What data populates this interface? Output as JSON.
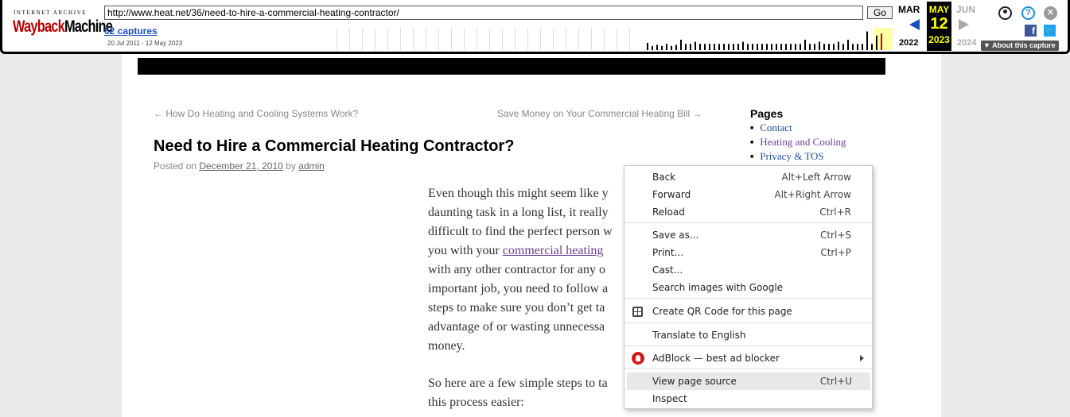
{
  "wayback": {
    "logo_top": "INTERNET ARCHIVE",
    "logo_part1": "Wayback",
    "logo_part2": "Machine",
    "url": "http://www.heat.net/36/need-to-hire-a-commercial-heating-contractor/",
    "go_label": "Go",
    "captures": "62 captures",
    "date_range": "20 Jul 2011 - 12 May 2023",
    "prev_month": "MAR",
    "cur_month": "MAY",
    "cur_day": "12",
    "cur_year": "2023",
    "next_month": "JUN",
    "prev_year": "2022",
    "next_year": "2024",
    "about": "About this capture",
    "help_glyph": "?",
    "close_glyph": "✕",
    "fb_glyph": "f",
    "tw_glyph": "🐦"
  },
  "article": {
    "prev_link": "← How Do Heating and Cooling Systems Work?",
    "next_link": "Save Money on Your Commercial Heating Bill →",
    "title": "Need to Hire a Commercial Heating Contractor?",
    "posted_prefix": "Posted on",
    "posted_date": "December 21, 2010",
    "posted_by": "by",
    "author": "admin",
    "lines": [
      "Even though this might seem like y",
      "daunting task in a long list, it really",
      "difficult to find the perfect person w",
      "you with your",
      "with any other contractor for any o",
      "important job, you need to follow a",
      "steps to make sure you don’t get ta",
      "advantage of or wasting unnecessa",
      "money."
    ],
    "link_text": "commercial heating",
    "p2_lines": [
      "So here are a few simple steps to ta",
      "this process easier:"
    ]
  },
  "sidebar": {
    "title": "Pages",
    "items": [
      "Contact",
      "Heating and Cooling",
      "Privacy & TOS"
    ]
  },
  "context_menu": {
    "back": "Back",
    "back_sc": "Alt+Left Arrow",
    "forward": "Forward",
    "forward_sc": "Alt+Right Arrow",
    "reload": "Reload",
    "reload_sc": "Ctrl+R",
    "save": "Save as...",
    "save_sc": "Ctrl+S",
    "print": "Print...",
    "print_sc": "Ctrl+P",
    "cast": "Cast...",
    "search_images": "Search images with Google",
    "qr": "Create QR Code for this page",
    "translate": "Translate to English",
    "adblock": "AdBlock — best ad blocker",
    "view_source": "View page source",
    "view_source_sc": "Ctrl+U",
    "inspect": "Inspect"
  },
  "sparkline_bars": [
    0.35,
    0.2,
    0.25,
    0.2,
    0.3,
    0.2,
    0.25,
    0.5,
    0.3,
    0.3,
    0.4,
    0.3,
    0.3,
    0.3,
    0.3,
    0.3,
    0.3,
    0.3,
    0.3,
    0.3,
    0.4,
    0.3,
    0.3,
    0.3,
    0.3,
    0.3,
    0.3,
    0.3,
    0.3,
    0.3,
    0.3,
    0.3,
    0.3,
    0.5,
    0.3,
    0.3,
    0.4,
    0.3,
    0.3,
    0.3,
    0.4,
    0.3,
    0.5,
    0.3,
    0.3,
    0.3,
    0.9,
    0.3,
    0.7,
    0.8
  ]
}
